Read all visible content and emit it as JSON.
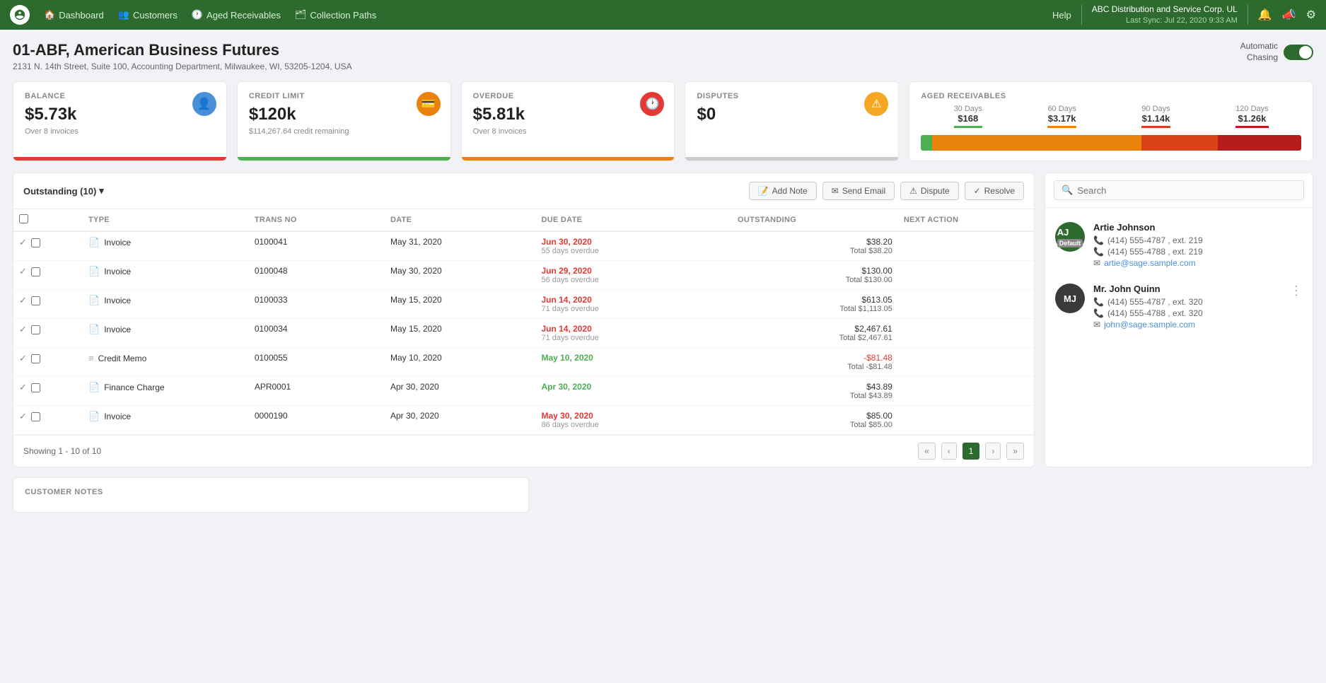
{
  "nav": {
    "logo_alt": "Sage logo",
    "links": [
      {
        "label": "Dashboard",
        "icon": "🏠"
      },
      {
        "label": "Customers",
        "icon": "👥"
      },
      {
        "label": "Aged Receivables",
        "icon": "🕐"
      },
      {
        "label": "Collection Paths",
        "icon": "🗂"
      }
    ],
    "help": "Help",
    "company": "ABC Distribution and Service Corp. UL",
    "sync": "Last Sync: Jul 22, 2020 9:33 AM"
  },
  "header": {
    "title": "01-ABF, American Business Futures",
    "address": "2131 N. 14th Street, Suite 100, Accounting Department, Milwaukee, WI, 53205-1204, USA",
    "auto_chasing_label": "Automatic\nChasing"
  },
  "stats": {
    "balance": {
      "label": "BALANCE",
      "value": "$5.73k",
      "sub": "Over 8 invoices",
      "bar_class": "red"
    },
    "credit_limit": {
      "label": "CREDIT LIMIT",
      "value": "$120k",
      "sub": "$114,267.64 credit remaining",
      "bar_class": "green"
    },
    "overdue": {
      "label": "OVERDUE",
      "value": "$5.81k",
      "sub": "Over 8 invoices",
      "bar_class": "orange"
    },
    "disputes": {
      "label": "DISPUTES",
      "value": "$0",
      "sub": "",
      "bar_class": "gray"
    }
  },
  "aged": {
    "label": "AGED RECEIVABLES",
    "buckets": [
      {
        "days": "30 Days",
        "amount": "$168"
      },
      {
        "days": "60 Days",
        "amount": "$3.17k"
      },
      {
        "days": "90 Days",
        "amount": "$1.14k"
      },
      {
        "days": "120 Days",
        "amount": "$1.26k"
      }
    ],
    "bar": [
      {
        "pct": 3,
        "color": "#4caf50"
      },
      {
        "pct": 55,
        "color": "#e8820c"
      },
      {
        "pct": 20,
        "color": "#d84315"
      },
      {
        "pct": 22,
        "color": "#b71c1c"
      }
    ]
  },
  "table": {
    "filter_label": "Outstanding (10)",
    "toolbar_buttons": [
      {
        "label": "Add Note",
        "icon": "📝"
      },
      {
        "label": "Send Email",
        "icon": "✉"
      },
      {
        "label": "Dispute",
        "icon": "⚠"
      },
      {
        "label": "Resolve",
        "icon": "✓"
      }
    ],
    "columns": [
      "TYPE",
      "TRANS NO",
      "DATE",
      "DUE DATE",
      "OUTSTANDING",
      "NEXT ACTION"
    ],
    "rows": [
      {
        "type": "Invoice",
        "trans": "0100041",
        "date": "May 31, 2020",
        "due": "Jun 30, 2020",
        "due_sub": "55 days overdue",
        "due_class": "red",
        "outstanding": "$38.20",
        "total": "Total $38.20",
        "neg": false
      },
      {
        "type": "Invoice",
        "trans": "0100048",
        "date": "May 30, 2020",
        "due": "Jun 29, 2020",
        "due_sub": "56 days overdue",
        "due_class": "red",
        "outstanding": "$130.00",
        "total": "Total $130.00",
        "neg": false
      },
      {
        "type": "Invoice",
        "trans": "0100033",
        "date": "May 15, 2020",
        "due": "Jun 14, 2020",
        "due_sub": "71 days overdue",
        "due_class": "red",
        "outstanding": "$613.05",
        "total": "Total $1,113.05",
        "neg": false
      },
      {
        "type": "Invoice",
        "trans": "0100034",
        "date": "May 15, 2020",
        "due": "Jun 14, 2020",
        "due_sub": "71 days overdue",
        "due_class": "red",
        "outstanding": "$2,467.61",
        "total": "Total $2,467.61",
        "neg": false
      },
      {
        "type": "Credit Memo",
        "trans": "0100055",
        "date": "May 10, 2020",
        "due": "May 10, 2020",
        "due_sub": "",
        "due_class": "green",
        "outstanding": "-$81.48",
        "total": "Total -$81.48",
        "neg": true
      },
      {
        "type": "Finance Charge",
        "trans": "APR0001",
        "date": "Apr 30, 2020",
        "due": "Apr 30, 2020",
        "due_sub": "",
        "due_class": "green",
        "outstanding": "$43.89",
        "total": "Total $43.89",
        "neg": false
      },
      {
        "type": "Invoice",
        "trans": "0000190",
        "date": "Apr 30, 2020",
        "due": "May 30, 2020",
        "due_sub": "86 days overdue",
        "due_class": "red",
        "outstanding": "$85.00",
        "total": "Total $85.00",
        "neg": false
      }
    ],
    "footer": {
      "showing": "Showing  1 - 10  of  10",
      "page": "1"
    }
  },
  "contacts": {
    "search_placeholder": "Search",
    "items": [
      {
        "initials": "AJ",
        "name": "Artie Johnson",
        "default": true,
        "phone1": "(414) 555-4787 , ext. 219",
        "phone2": "(414) 555-4788 , ext. 219",
        "email": "artie@sage.sample.com",
        "bg": "green"
      },
      {
        "initials": "MJ",
        "name": "Mr. John Quinn",
        "default": false,
        "phone1": "(414) 555-4787 , ext. 320",
        "phone2": "(414) 555-4788 , ext. 320",
        "email": "john@sage.sample.com",
        "bg": "dark"
      }
    ]
  },
  "notes": {
    "label": "CUSTOMER NOTES"
  }
}
